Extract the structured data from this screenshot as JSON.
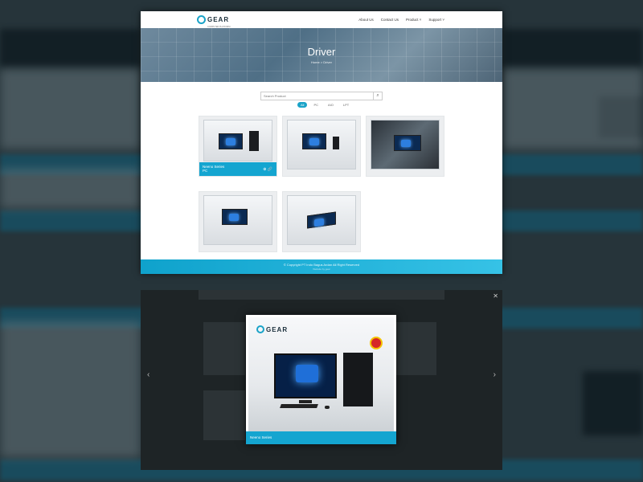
{
  "nav": {
    "logo": "GEAR",
    "logo_sub": "COMPUTER PLATFORM",
    "menu": [
      "About Us",
      "Contact Us",
      "Product ˅",
      "Support ˅"
    ]
  },
  "hero": {
    "title": "Driver",
    "breadcrumb": "Home > Driver"
  },
  "search": {
    "placeholder": "Search Product",
    "icon": "search-icon"
  },
  "filters": [
    "All",
    "PC",
    "AIO",
    "LPT"
  ],
  "cards": [
    {
      "caption": "Neeno Series",
      "caption_sub": "PC",
      "icons": "⊕ 🔗"
    }
  ],
  "footer": {
    "text": "© Copyright PT Indo Bagus Ardan All Right Reserved",
    "sub": "Website by gear"
  },
  "modal": {
    "logo": "GEAR",
    "caption": "Neeno Series"
  },
  "colors": {
    "accent": "#14a5d0",
    "dark": "#1e2426"
  }
}
